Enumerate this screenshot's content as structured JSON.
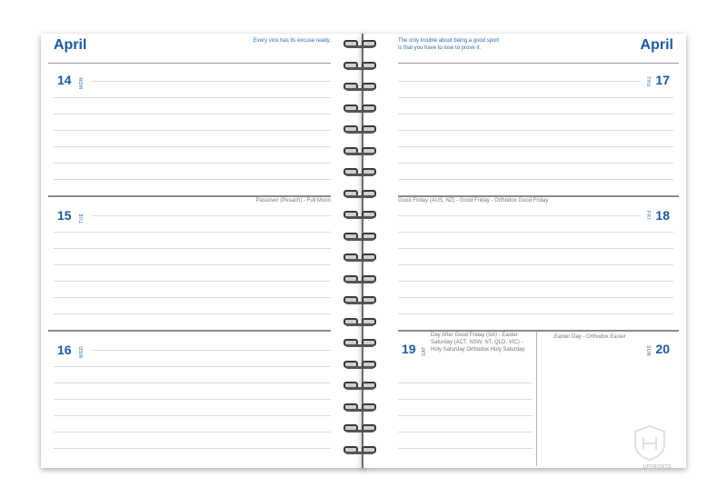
{
  "left_page": {
    "month": "April",
    "quote": "Every vice has its excuse ready.",
    "days": [
      {
        "number": "14",
        "dow": "MON",
        "event": ""
      },
      {
        "number": "15",
        "dow": "TUE",
        "event": "Passover (Pesach) - Full Moon"
      },
      {
        "number": "16",
        "dow": "WED",
        "event": ""
      }
    ]
  },
  "right_page": {
    "month": "April",
    "quote_line1": "The only trouble about being a good sport",
    "quote_line2": "is that you have to lose to prove it.",
    "days": [
      {
        "number": "17",
        "dow": "THU",
        "event": ""
      },
      {
        "number": "18",
        "dow": "FRI",
        "event": "Good Friday (AUS, NZ) - Good Friday - Orthodox Good Friday"
      },
      {
        "number": "19",
        "dow": "SAT",
        "event": "Day After Good Friday (SA) - Easter Saturday (ACT, NSW, NT, QLD, VIC) - Holy Saturday Orthodox Holy Saturday"
      },
      {
        "number": "20",
        "dow": "SUN",
        "event": "Easter Day - Orthodox Easter"
      }
    ]
  },
  "logo": {
    "icon": "publisher-shield-icon",
    "text": "UPFRONTS"
  }
}
